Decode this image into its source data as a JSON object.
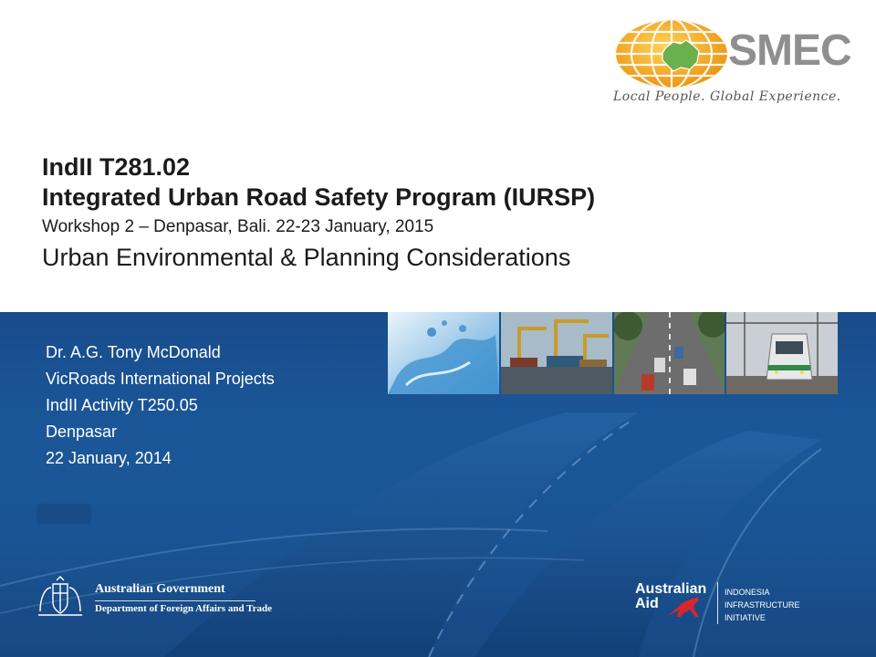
{
  "logo": {
    "brand": "SMEC",
    "tagline": "Local People. Global Experience.",
    "brand_color": "#8f8f8f",
    "globe_color": "#f2a31b",
    "australia_color": "#6ab04c"
  },
  "title": {
    "code": "IndII T281.02",
    "program": "Integrated Urban Road Safety Program (IURSP)",
    "workshop": "Workshop 2 – Denpasar, Bali. 22-23 January, 2015",
    "topic": "Urban Environmental & Planning  Considerations"
  },
  "presenter": {
    "lines": [
      "Dr. A.G. Tony McDonald",
      "VicRoads International  Projects",
      "IndII Activity T250.05",
      "Denpasar",
      "22 January, 2014"
    ]
  },
  "photos": [
    {
      "icon": "water-splash-icon"
    },
    {
      "icon": "port-cranes-icon"
    },
    {
      "icon": "traffic-road-icon"
    },
    {
      "icon": "commuter-train-icon"
    }
  ],
  "footer": {
    "gov_line1": "Australian Government",
    "gov_line2": "Department of Foreign Affairs and Trade",
    "aid_line1": "Australian",
    "aid_line2": "Aid",
    "iii_lines": [
      "INDONESIA",
      "INFRASTRUCTURE",
      "INITIATIVE"
    ]
  },
  "colors": {
    "band": "#1d5a9e",
    "aid_red": "#d9262c"
  }
}
